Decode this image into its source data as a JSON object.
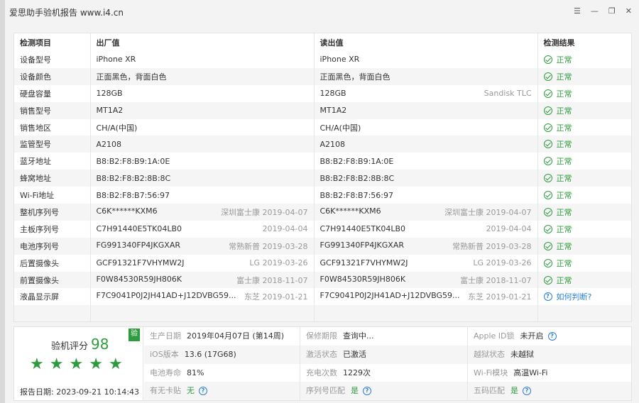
{
  "window": {
    "title": "爱思助手验机报告 www.i4.cn"
  },
  "table": {
    "headers": [
      "检测项目",
      "出厂值",
      "读出值",
      "检测结果"
    ],
    "rows": [
      {
        "item": "设备型号",
        "factory": "iPhone XR",
        "factory_note": "",
        "read": "iPhone XR",
        "read_note": "",
        "result": "正常"
      },
      {
        "item": "设备颜色",
        "factory": "正面黑色，背面白色",
        "factory_note": "",
        "read": "正面黑色，背面白色",
        "read_note": "",
        "result": "正常"
      },
      {
        "item": "硬盘容量",
        "factory": "128GB",
        "factory_note": "",
        "read": "128GB",
        "read_note": "Sandisk TLC",
        "result": "正常"
      },
      {
        "item": "销售型号",
        "factory": "MT1A2",
        "factory_note": "",
        "read": "MT1A2",
        "read_note": "",
        "result": "正常"
      },
      {
        "item": "销售地区",
        "factory": "CH/A(中国)",
        "factory_note": "",
        "read": "CH/A(中国)",
        "read_note": "",
        "result": "正常"
      },
      {
        "item": "监管型号",
        "factory": "A2108",
        "factory_note": "",
        "read": "A2108",
        "read_note": "",
        "result": "正常"
      },
      {
        "item": "蓝牙地址",
        "factory": "B8:B2:F8:B9:1A:0E",
        "factory_note": "",
        "read": "B8:B2:F8:B9:1A:0E",
        "read_note": "",
        "result": "正常"
      },
      {
        "item": "蜂窝地址",
        "factory": "B8:B2:F8:B2:8B:8C",
        "factory_note": "",
        "read": "B8:B2:F8:B2:8B:8C",
        "read_note": "",
        "result": "正常"
      },
      {
        "item": "Wi-Fi地址",
        "factory": "B8:B2:F8:B7:56:97",
        "factory_note": "",
        "read": "B8:B2:F8:B7:56:97",
        "read_note": "",
        "result": "正常"
      },
      {
        "item": "整机序列号",
        "factory": "C6K******KXM6",
        "factory_note": "深圳富士康  2019-04-07",
        "read": "C6K******KXM6",
        "read_note": "深圳富士康  2019-04-07",
        "result": "正常"
      },
      {
        "item": "主板序列号",
        "factory": "C7H91440E5TK04LB0",
        "factory_note": "2019-04-04",
        "read": "C7H91440E5TK04LB0",
        "read_note": "2019-04-04",
        "result": "正常"
      },
      {
        "item": "电池序列号",
        "factory": "FG991340FP4JKGXAR",
        "factory_note": "常熟新普  2019-03-28",
        "read": "FG991340FP4JKGXAR",
        "read_note": "常熟新普  2019-03-28",
        "result": "正常"
      },
      {
        "item": "后置摄像头",
        "factory": "GCF91321F7VHYMW2J",
        "factory_note": "LG  2019-03-26",
        "read": "GCF91321F7VHYMW2J",
        "read_note": "LG  2019-03-26",
        "result": "正常"
      },
      {
        "item": "前置摄像头",
        "factory": "F0W84530R59JH806K",
        "factory_note": "富士康  2018-11-07",
        "read": "F0W84530R59JH806K",
        "read_note": "富士康  2018-11-07",
        "result": "正常"
      },
      {
        "item": "液晶显示屏",
        "factory": "F7C9041P0J2JH41AD+J12DVBG59...",
        "factory_note": "东芝  2019-01-21",
        "read": "F7C9041P0J2JH41AD+J12DVBG59...",
        "read_note": "东芝  2019-01-21",
        "result": "如何判断?",
        "result_type": "question"
      }
    ]
  },
  "summary": {
    "score_label": "验机评分",
    "score": "98",
    "badge": "验",
    "stars": 5,
    "report_date": "报告日期:  2023-09-21 10:14:43",
    "info": [
      [
        {
          "k": "生产日期",
          "v": "2019年04月07日 (第14周)"
        },
        {
          "k": "保修期限",
          "v": "查询中..."
        },
        {
          "k": "Apple ID锁",
          "v": "未开启",
          "q": true
        }
      ],
      [
        {
          "k": "iOS版本",
          "v": "13.6 (17G68)"
        },
        {
          "k": "激活状态",
          "v": "已激活"
        },
        {
          "k": "越狱状态",
          "v": "未越狱"
        }
      ],
      [
        {
          "k": "电池寿命",
          "v": "81%"
        },
        {
          "k": "充电次数",
          "v": "1229次"
        },
        {
          "k": "Wi-Fi模块",
          "v": "高温Wi-Fi"
        }
      ],
      [
        {
          "k": "有无卡贴",
          "v": "无",
          "green": true,
          "q": true
        },
        {
          "k": "序列号匹配",
          "v": "是",
          "green": true,
          "q": true
        },
        {
          "k": "五码匹配",
          "v": "是",
          "green": true,
          "q": true
        }
      ]
    ]
  }
}
